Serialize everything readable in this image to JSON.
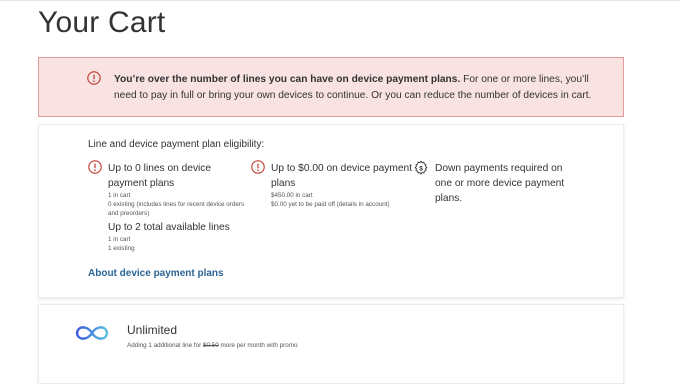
{
  "page": {
    "title": "Your Cart"
  },
  "alert": {
    "bold_text": "You’re over the number of lines you can have on device payment plans.",
    "text": " For one or more lines, you’ll need to pay in full or bring your own devices to continue. Or you can reduce the number of devices in cart.",
    "color": "#c0392b"
  },
  "eligibility": {
    "title": "Line and device payment plan eligibility:",
    "col1": {
      "main": "Up to 0 lines on device payment plans",
      "line1": "1 in cart",
      "line2": "0 existing (includes lines for recent device orders and preorders)",
      "main2": "Up to 2 total available lines",
      "line3": "1 in cart",
      "line4": "1 existing"
    },
    "col2": {
      "main": "Up to $0.00 on device payment plans",
      "line1": "$450.00 in cart",
      "line2": "$0.00 yet to be paid off (details in account)"
    },
    "col3": {
      "main": "Down payments required on one or more device payment plans."
    },
    "link": "About device payment plans"
  },
  "plan": {
    "name": "Unlimited",
    "sub_prefix": "Adding 1 additional line for ",
    "sub_strike": "$0.50",
    "sub_suffix": " more per month with promo",
    "icon": "infinity-icon"
  }
}
